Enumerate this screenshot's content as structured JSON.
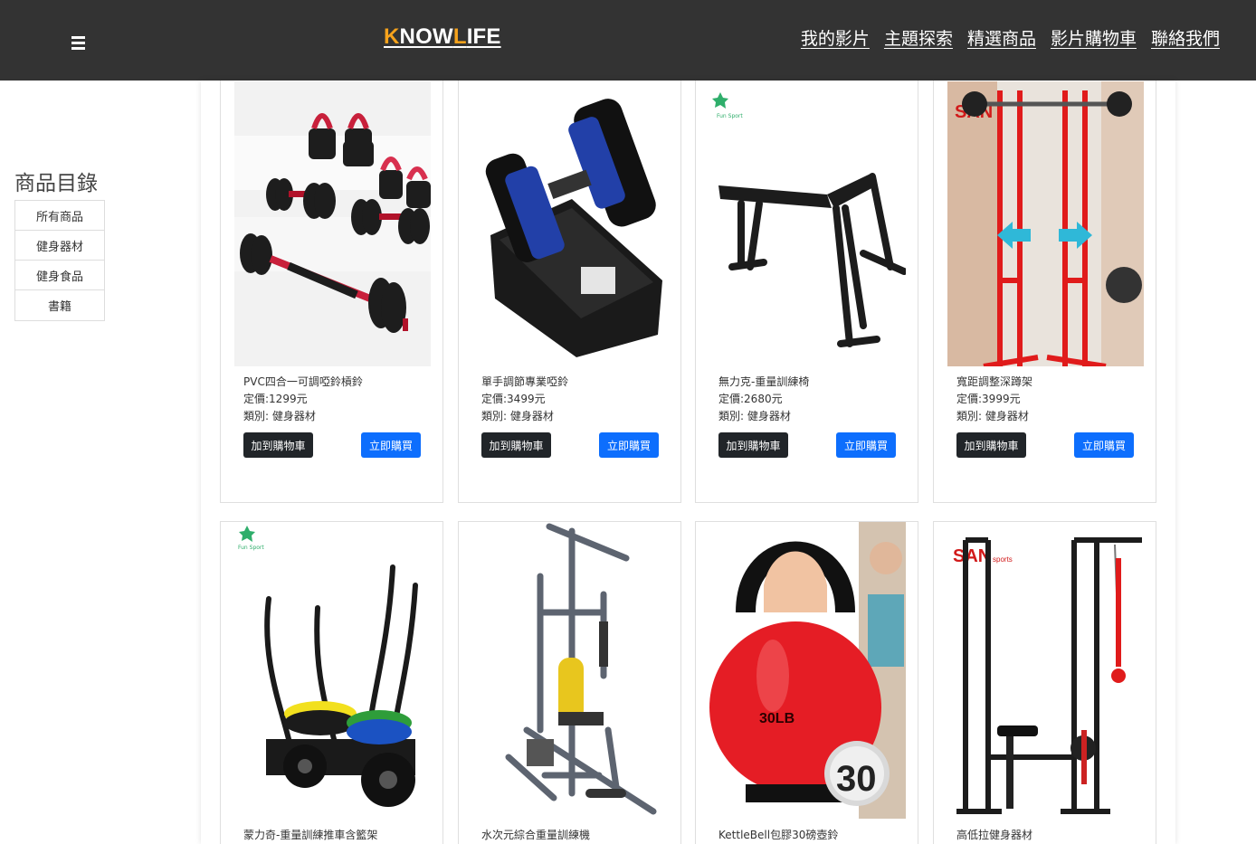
{
  "header": {
    "logo_k": "K",
    "logo_now": "NOW",
    "logo_l": "L",
    "logo_ife": "IFE",
    "nav": [
      "我的影片",
      "主題探索",
      "精選商品",
      "影片購物車",
      "聯絡我們"
    ]
  },
  "sidebar": {
    "title": "商品目錄",
    "items": [
      "所有商品",
      "健身器材",
      "健身食品",
      "書籍"
    ]
  },
  "products": [
    {
      "name": "PVC四合一可調啞鈴槓鈴",
      "price": "定價:1299元",
      "category": "類別: 健身器材",
      "cart": "加到購物車",
      "buy": "立即購買"
    },
    {
      "name": "單手調節專業啞鈴",
      "price": "定價:3499元",
      "category": "類別: 健身器材",
      "cart": "加到購物車",
      "buy": "立即購買"
    },
    {
      "name": "無力克-重量訓練椅",
      "price": "定價:2680元",
      "category": "類別: 健身器材",
      "cart": "加到購物車",
      "buy": "立即購買"
    },
    {
      "name": "寬距調整深蹲架",
      "price": "定價:3999元",
      "category": "類別: 健身器材",
      "cart": "加到購物車",
      "buy": "立即購買"
    },
    {
      "name": "蒙力奇-重量訓練推車含籃架"
    },
    {
      "name": "水次元綜合重量訓練機"
    },
    {
      "name": "KettleBell包膠30磅壺鈴"
    },
    {
      "name": "高低拉健身器材"
    }
  ],
  "image_text": {
    "brand_san": "SAN",
    "brand_sports": "sports",
    "brand_fun": "Fun Sport",
    "kettlebell_weight": "30LB",
    "kettlebell_badge": "30"
  },
  "colors": {
    "header_bg": "#333333",
    "logo_accent": "#f7a31c",
    "cart_button": "#212529",
    "buy_button": "#0d6efd"
  }
}
